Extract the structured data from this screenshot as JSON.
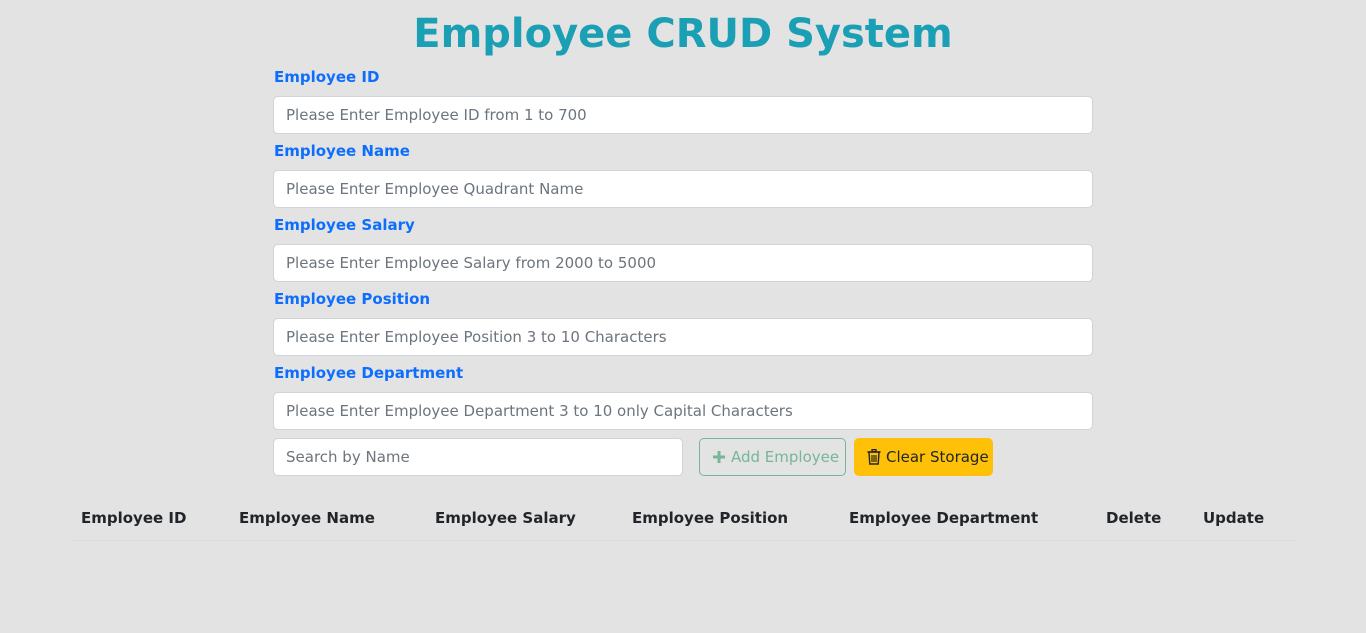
{
  "page": {
    "title": "Employee CRUD System"
  },
  "form": {
    "fields": [
      {
        "label": "Employee ID",
        "placeholder": "Please Enter Employee ID from 1 to 700",
        "value": ""
      },
      {
        "label": "Employee Name",
        "placeholder": "Please Enter Employee Quadrant Name",
        "value": ""
      },
      {
        "label": "Employee Salary",
        "placeholder": "Please Enter Employee Salary from 2000 to 5000",
        "value": ""
      },
      {
        "label": "Employee Position",
        "placeholder": "Please Enter Employee Position 3 to 10 Characters",
        "value": ""
      },
      {
        "label": "Employee Department",
        "placeholder": "Please Enter Employee Department 3 to 10 only Capital Characters",
        "value": ""
      }
    ]
  },
  "controls": {
    "search_placeholder": "Search by Name",
    "add_label": "Add Employee",
    "clear_label": "Clear Storage"
  },
  "table": {
    "columns": [
      "Employee ID",
      "Employee Name",
      "Employee Salary",
      "Employee Position",
      "Employee Department",
      "Delete",
      "Update"
    ],
    "rows": []
  },
  "colors": {
    "title": "#1b9fb4",
    "label": "#0d6efd",
    "add_button": "#75b798",
    "clear_button": "#ffc107",
    "background": "#e3e3e3"
  },
  "icons": {
    "add": "plus-icon",
    "clear": "trash-icon"
  }
}
